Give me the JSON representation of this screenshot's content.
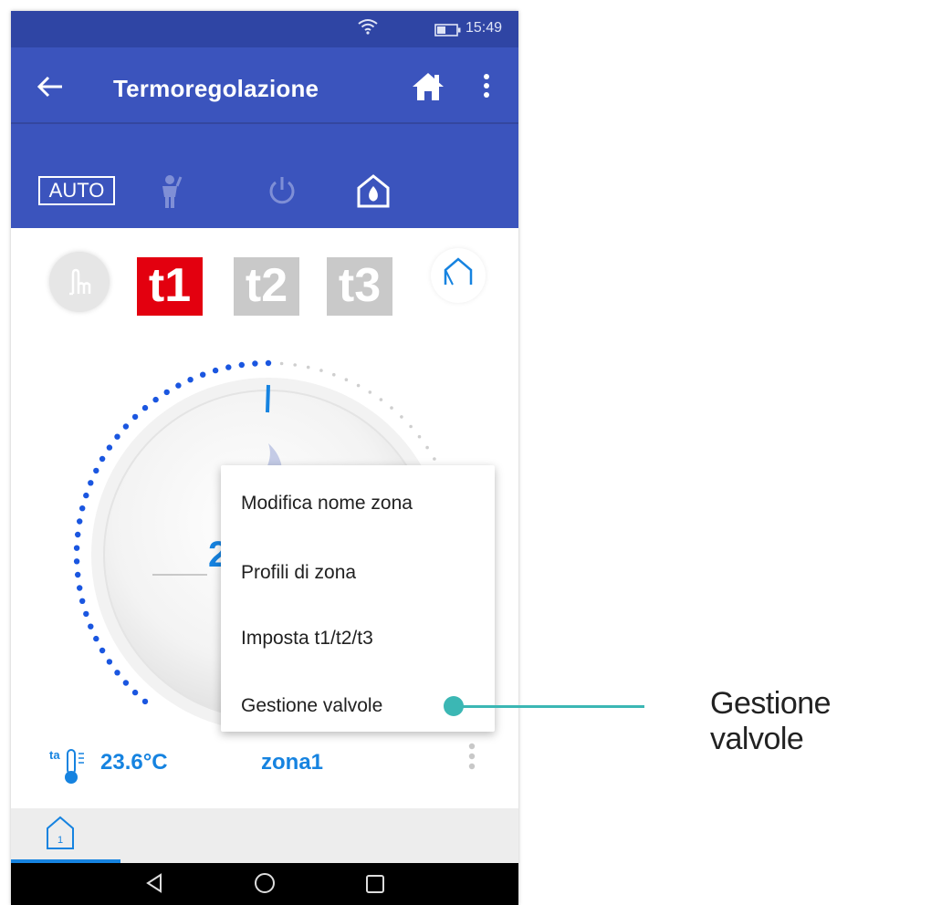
{
  "statusbar": {
    "time": "15:49",
    "wifi_icon": "wifi-icon",
    "battery_icon": "battery-icon"
  },
  "appbar": {
    "title": "Termoregolazione",
    "back_icon": "arrow-left-icon",
    "home_icon": "home-icon",
    "more_icon": "more-vertical-icon"
  },
  "modes": {
    "auto_label": "AUTO",
    "manual_icon": "manual-person-icon",
    "power_icon": "power-icon",
    "antifreeze_icon": "house-flame-icon"
  },
  "setpoints": {
    "t1": "t1",
    "t2": "t2",
    "t3": "t3",
    "active": "t1"
  },
  "dial": {
    "setpoint_partial": "2"
  },
  "menu": {
    "items": [
      "Modifica nome zona",
      "Profili di zona",
      "Imposta t1/t2/t3",
      "Gestione valvole"
    ]
  },
  "zone": {
    "temperature": "23.6°C",
    "name": "zona1",
    "ta_label": "ta"
  },
  "tabs": {
    "active_tab_number": "1"
  },
  "callout": {
    "label": "Gestione valvole"
  },
  "colors": {
    "appbar": "#3b54bd",
    "statusbar": "#2f45a4",
    "accent_blue": "#1683e0",
    "t1_red": "#e3000f",
    "inactive_grey": "#c9c9c9",
    "callout_teal": "#3bb7b4"
  }
}
